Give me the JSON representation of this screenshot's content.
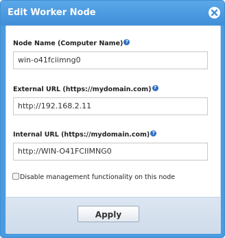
{
  "dialog": {
    "title": "Edit Worker Node",
    "close_icon": "close-x-icon"
  },
  "fields": [
    {
      "label": "Node Name (Computer Name)",
      "value": "win-o41fciimng0"
    },
    {
      "label": "External URL (https://mydomain.com)",
      "value": "http://192.168.2.11"
    },
    {
      "label": "Internal URL (https://mydomain.com)",
      "value": "http://WIN-O41FCIIMNG0"
    }
  ],
  "help_glyph": "?",
  "checkbox": {
    "label": "Disable management functionality on this node",
    "checked": false
  },
  "footer": {
    "apply_label": "Apply"
  },
  "colors": {
    "titlebar": "#4a9be0",
    "help_icon": "#2f6fc4",
    "footer": "#d6e1ee"
  }
}
